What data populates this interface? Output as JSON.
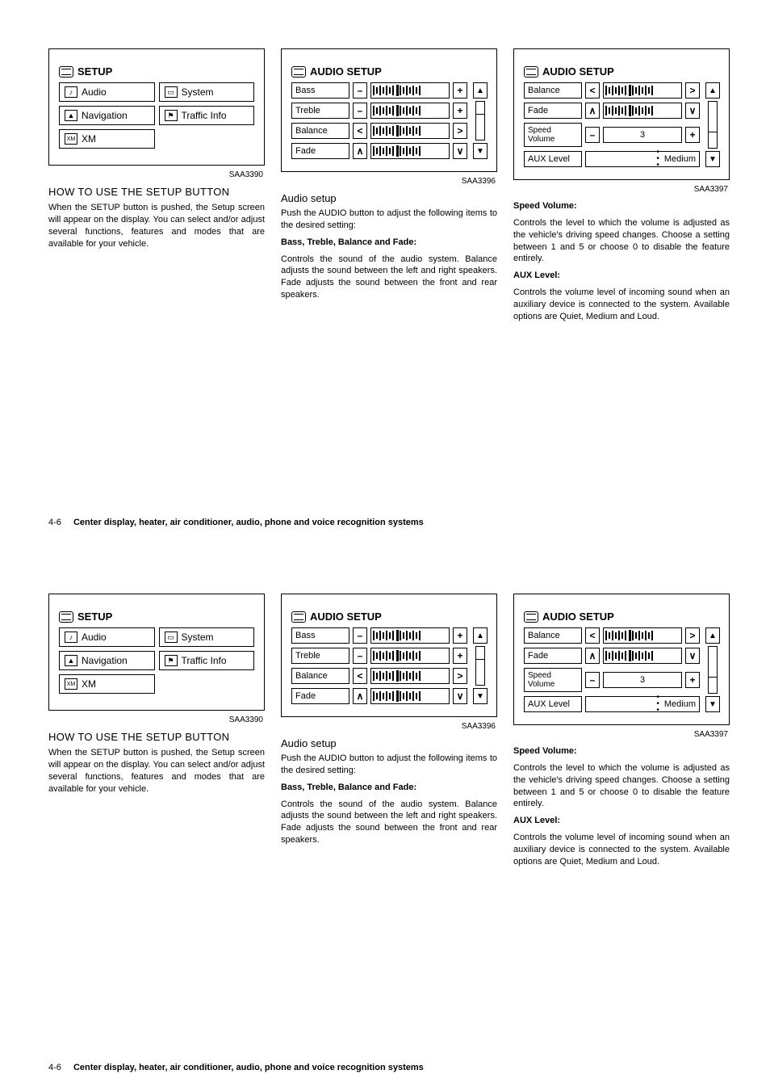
{
  "setup_panel": {
    "title": "SETUP",
    "caption": "SAA3390",
    "items": [
      {
        "label": "Audio",
        "icon": "note"
      },
      {
        "label": "System",
        "icon": "monitor"
      },
      {
        "label": "Navigation",
        "icon": "compass"
      },
      {
        "label": "Traffic Info",
        "icon": "traffic"
      },
      {
        "label": "XM",
        "icon": "xm"
      }
    ]
  },
  "audio_panel_1": {
    "title": "AUDIO SETUP",
    "caption": "SAA3396",
    "rows": [
      {
        "label": "Bass",
        "dec": "–",
        "inc": "+"
      },
      {
        "label": "Treble",
        "dec": "–",
        "inc": "+"
      },
      {
        "label": "Balance",
        "dec": "<",
        "inc": ">"
      },
      {
        "label": "Fade",
        "dec": "∧",
        "inc": "∨"
      }
    ]
  },
  "audio_panel_2": {
    "title": "AUDIO SETUP",
    "caption": "SAA3397",
    "rows": [
      {
        "label": "Balance",
        "dec": "<",
        "inc": ">",
        "type": "bar"
      },
      {
        "label": "Fade",
        "dec": "∧",
        "inc": "∨",
        "type": "bar"
      },
      {
        "label": "Speed Volume",
        "dec": "–",
        "inc": "+",
        "type": "num",
        "value": "3"
      },
      {
        "label": "AUX Level",
        "type": "opt",
        "value": "Medium"
      }
    ]
  },
  "col1": {
    "heading": "HOW TO USE THE SETUP BUTTON",
    "p1": "When the SETUP button is pushed, the Setup screen will appear on the display. You can select and/or adjust several functions, features and modes that are available for your vehicle."
  },
  "col2": {
    "heading": "Audio setup",
    "p1": "Push the AUDIO button to adjust the following items to the desired setting:",
    "sub1": "Bass, Treble, Balance and Fade:",
    "p2": "Controls the sound of the audio system. Balance adjusts the sound between the left and right speakers. Fade adjusts the sound between the front and rear speakers."
  },
  "col3": {
    "sub1": "Speed Volume:",
    "p1": "Controls the level to which the volume is adjusted as the vehicle's driving speed changes. Choose a setting between 1 and 5 or choose 0 to disable the feature entirely.",
    "sub2": "AUX Level:",
    "p2": "Controls the volume level of incoming sound when an auxiliary device is connected to the system. Available options are Quiet, Medium and Loud."
  },
  "footer": {
    "page_num": "4-6",
    "section": "Center display, heater, air conditioner, audio, phone and voice recognition systems"
  }
}
